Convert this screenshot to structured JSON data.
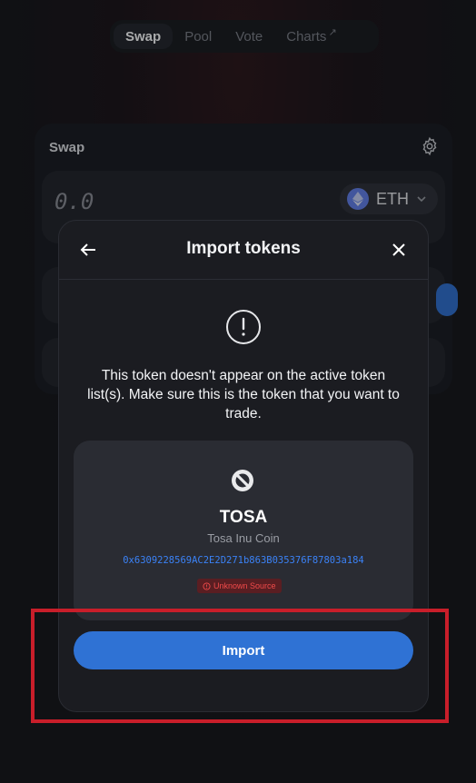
{
  "nav": {
    "items": [
      {
        "label": "Swap"
      },
      {
        "label": "Pool"
      },
      {
        "label": "Vote"
      },
      {
        "label": "Charts",
        "suffix": "↗"
      }
    ]
  },
  "swap": {
    "title": "Swap",
    "amount": "0.0",
    "token": "ETH"
  },
  "modal": {
    "title": "Import tokens",
    "warning": "This token doesn't appear on the active token list(s). Make sure this is the token that you want to trade.",
    "token": {
      "symbol": "TOSA",
      "name": "Tosa Inu Coin",
      "address": "0x6309228569AC2E2D271b863B035376F87803a184",
      "source_badge": "Unknown Source"
    },
    "import_label": "Import"
  },
  "colors": {
    "accent": "#2f72d4",
    "warning_red": "#f04a4a",
    "highlight": "#c81e2a"
  },
  "icons": [
    "back-arrow-icon",
    "close-icon",
    "gear-icon",
    "warning-icon",
    "blocked-icon",
    "eth-icon",
    "chevron-down-icon"
  ]
}
